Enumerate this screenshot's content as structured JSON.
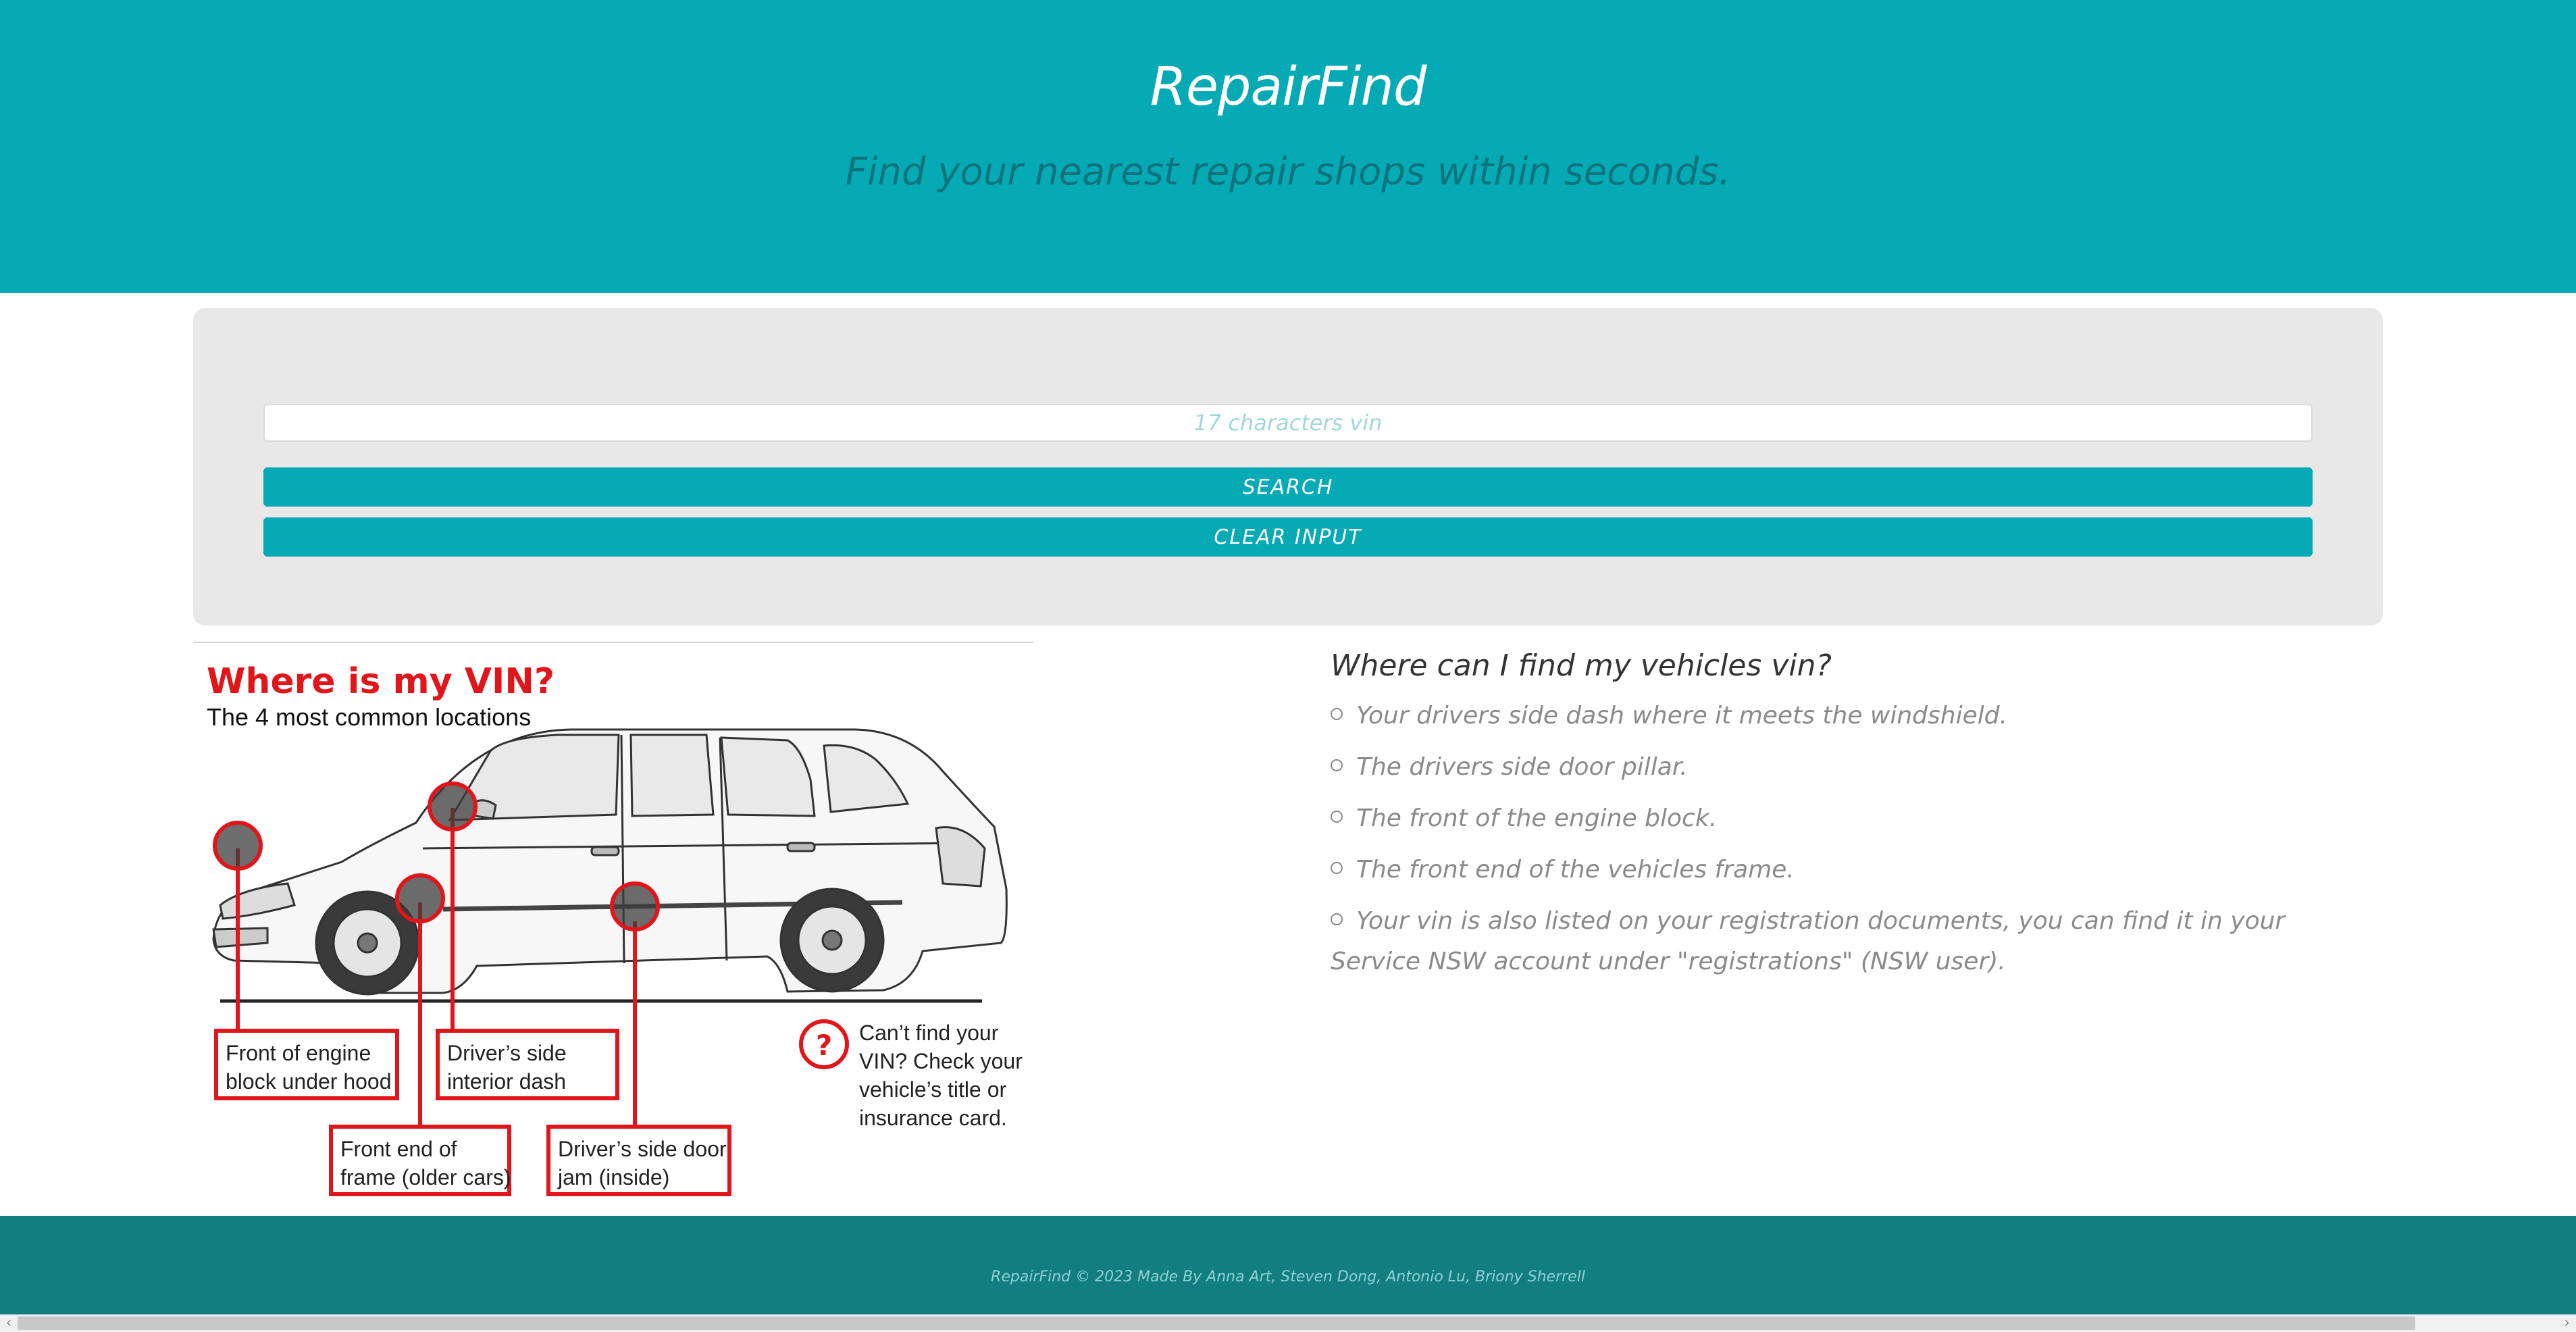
{
  "header": {
    "brand": "RepairFind",
    "tagline": "Find your nearest repair shops within seconds."
  },
  "search": {
    "placeholder": "17 characters vin",
    "value": "",
    "search_label": "SEARCH",
    "clear_label": "CLEAR INPUT"
  },
  "vin_figure": {
    "title": "Where is my VIN?",
    "subtitle": "The 4 most common locations",
    "labels": {
      "engine_line1": "Front of engine",
      "engine_line2": "block under hood",
      "dash_line1": "Driver’s side",
      "dash_line2": "interior dash",
      "frame_line1": "Front end of",
      "frame_line2": "frame (older cars)",
      "door_line1": "Driver’s side door",
      "door_line2": "jam (inside)",
      "help_line1": "Can’t find your",
      "help_line2": "VIN? Check your",
      "help_line3": "vehicle’s title or",
      "help_line4": "insurance card.",
      "help_symbol": "?"
    }
  },
  "info": {
    "title": "Where can I find my vehicles vin?",
    "items": [
      "Your drivers side dash where it meets the windshield.",
      "The drivers side door pillar.",
      "The front of the engine block.",
      "The front end of the vehicles frame.",
      "Your vin is also listed on your registration documents, you can find it in your Service NSW account under \"registrations\" (NSW user)."
    ]
  },
  "footer": {
    "text": "RepairFind © 2023 Made By Anna Art, Steven Dong, Antonio Lu, Briony Sherrell"
  },
  "scrollbar": {
    "left_arrow": "‹",
    "right_arrow": "›"
  },
  "colors": {
    "brand_teal": "#05aab5",
    "footer_teal": "#127e80",
    "panel_gray": "#e8e8e8",
    "highlight_red": "#e0161b"
  }
}
